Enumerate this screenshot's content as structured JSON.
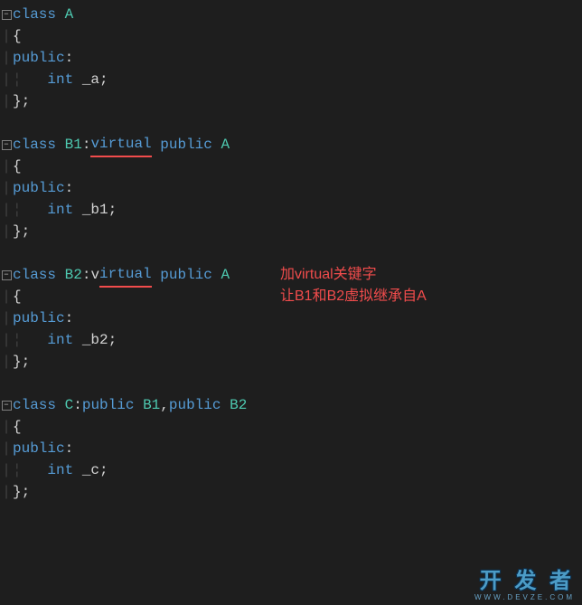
{
  "code": {
    "classA": {
      "kw_class": "class",
      "name": "A",
      "brace_open": "{",
      "kw_public": "public",
      "colon": ":",
      "kw_int": "int",
      "member": "_a",
      "semi": ";",
      "brace_close": "}",
      "end_semi": ";"
    },
    "classB1": {
      "kw_class": "class",
      "name": "B1",
      "colon": ":",
      "kw_virtual": "virtual",
      "kw_public_inh": "public",
      "base": "A",
      "brace_open": "{",
      "kw_public": "public",
      "colon2": ":",
      "kw_int": "int",
      "member": "_b1",
      "semi": ";",
      "brace_close": "}",
      "end_semi": ";"
    },
    "classB2": {
      "kw_class": "class",
      "name": "B2",
      "colon": ":",
      "kw_virtual": "virtual",
      "kw_public_inh": "public",
      "base": "A",
      "brace_open": "{",
      "kw_public": "public",
      "colon2": ":",
      "kw_int": "int",
      "member": "_b2",
      "semi": ";",
      "brace_close": "}",
      "end_semi": ";"
    },
    "classC": {
      "kw_class": "class",
      "name": "C",
      "colon": ":",
      "kw_public1": "public",
      "base1": "B1",
      "comma": ",",
      "kw_public2": "public",
      "base2": "B2",
      "brace_open": "{",
      "kw_public": "public",
      "colon2": ":",
      "kw_int": "int",
      "member": "_c",
      "semi": ";",
      "brace_close": "}",
      "end_semi": ";"
    }
  },
  "annotation": {
    "line1": "加virtual关键字",
    "line2": "让B1和B2虚拟继承自A"
  },
  "watermark": {
    "main": "开 发 者",
    "sub": "WWW.DEVZE.COM"
  },
  "fold_symbol": "−"
}
